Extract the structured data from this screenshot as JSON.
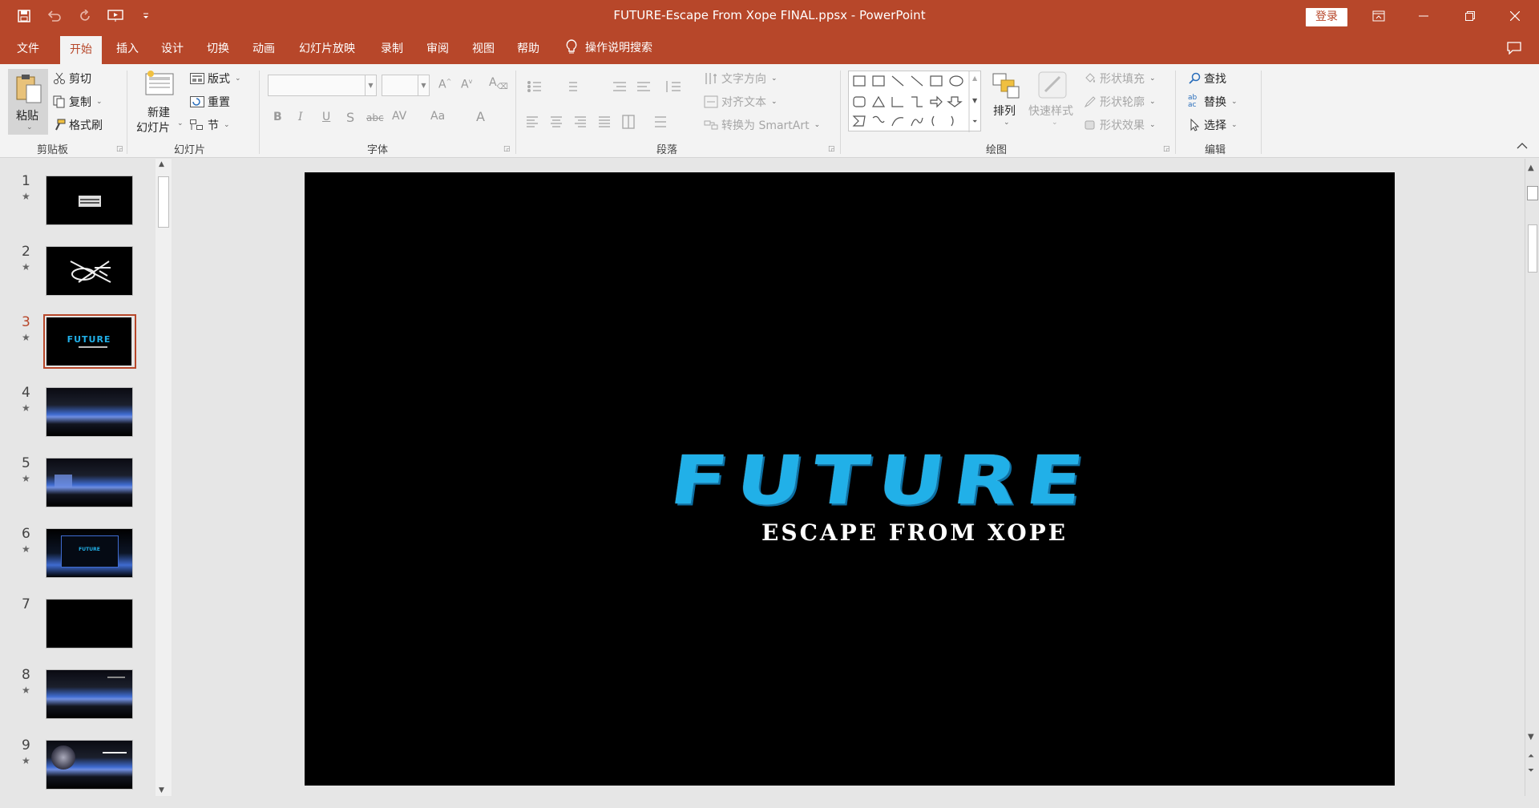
{
  "title_bar": {
    "title": "FUTURE-Escape From Xope FINAL.ppsx  -  PowerPoint",
    "login": "登录"
  },
  "tabs": {
    "items": [
      "文件",
      "开始",
      "插入",
      "设计",
      "切换",
      "动画",
      "幻灯片放映",
      "录制",
      "审阅",
      "视图",
      "帮助"
    ],
    "search": "操作说明搜索"
  },
  "ribbon": {
    "clipboard": {
      "paste": "粘贴",
      "cut": "剪切",
      "copy": "复制",
      "format_painter": "格式刷",
      "label": "剪贴板"
    },
    "slides": {
      "new_slide_line1": "新建",
      "new_slide_line2": "幻灯片",
      "layout": "版式",
      "reset": "重置",
      "section": "节",
      "label": "幻灯片"
    },
    "font": {
      "label": "字体",
      "bold": "B",
      "italic": "I",
      "underline": "U",
      "shadow": "S",
      "strike": "abc",
      "spacing": "AV",
      "case": "Aa",
      "color": "A"
    },
    "paragraph": {
      "label": "段落",
      "text_direction": "文字方向",
      "align_text": "对齐文本",
      "smartart": "转换为 SmartArt"
    },
    "drawing": {
      "label": "绘图",
      "arrange": "排列",
      "quick_styles": "快速样式",
      "shape_fill": "形状填充",
      "shape_outline": "形状轮廓",
      "shape_effects": "形状效果"
    },
    "editing": {
      "label": "编辑",
      "find": "查找",
      "replace": "替换",
      "select": "选择"
    }
  },
  "slides": [
    {
      "num": "1",
      "star": "★"
    },
    {
      "num": "2",
      "star": "★"
    },
    {
      "num": "3",
      "star": "★",
      "thumb_text": "FUTURE"
    },
    {
      "num": "4",
      "star": "★"
    },
    {
      "num": "5",
      "star": "★"
    },
    {
      "num": "6",
      "star": "★",
      "thumb_text": "FUTURE"
    },
    {
      "num": "7",
      "star": ""
    },
    {
      "num": "8",
      "star": "★"
    },
    {
      "num": "9",
      "star": "★"
    }
  ],
  "current_slide": {
    "title": "FUTURE",
    "subtitle": "ESCAPE FROM XOPE"
  },
  "colors": {
    "accent": "#b7472a",
    "logo_blue": "#21b0e8"
  }
}
